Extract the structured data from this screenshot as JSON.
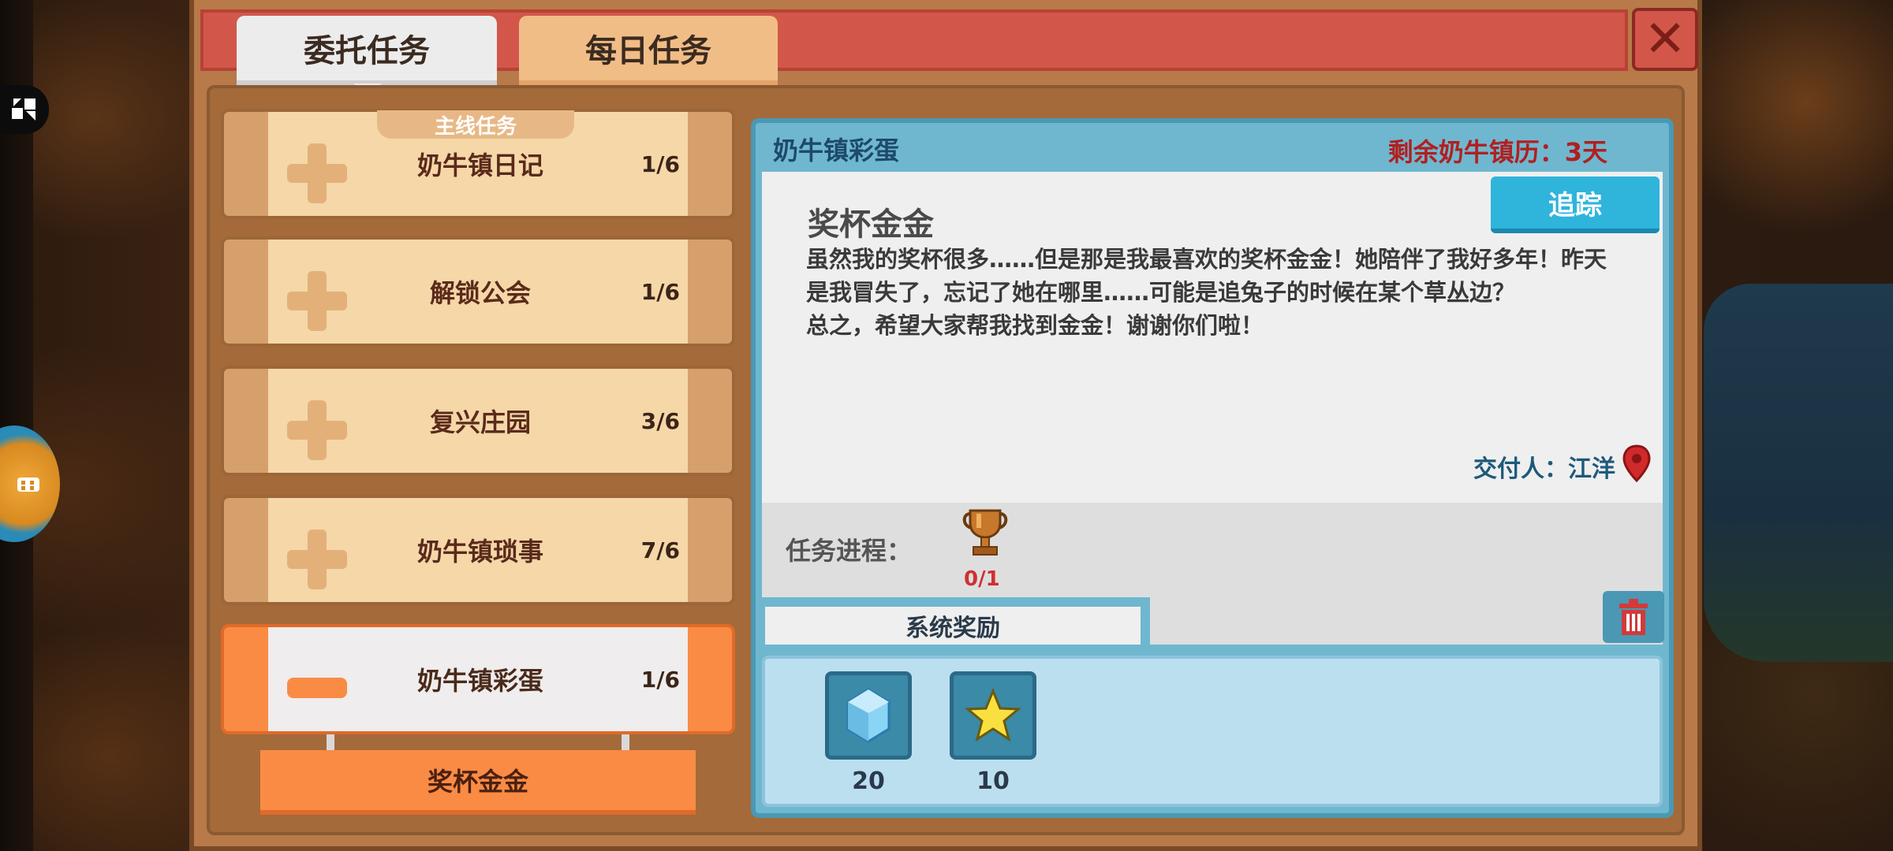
{
  "tabs": {
    "commission": "委托任务",
    "daily": "每日任务"
  },
  "close_label": "✕",
  "side_buttons": {
    "top_icon": "puzzle-expand-icon",
    "round_icon": "gamepad-icon"
  },
  "quest_list": {
    "section_tag": "主线任务",
    "items": [
      {
        "name": "奶牛镇日记",
        "progress": "1/6",
        "state": "collapsed"
      },
      {
        "name": "解锁公会",
        "progress": "1/6",
        "state": "collapsed"
      },
      {
        "name": "复兴庄园",
        "progress": "3/6",
        "state": "collapsed"
      },
      {
        "name": "奶牛镇琐事",
        "progress": "7/6",
        "state": "collapsed"
      },
      {
        "name": "奶牛镇彩蛋",
        "progress": "1/6",
        "state": "expanded"
      }
    ],
    "sub_quest": "奖杯金金"
  },
  "detail": {
    "chapter": "奶牛镇彩蛋",
    "remaining": "剩余奶牛镇历：3天",
    "quest_title": "奖杯金金",
    "track_button": "追踪",
    "description_lines": [
      "虽然我的奖杯很多……但是那是我最喜欢的奖杯金金！她陪伴了我好多年！昨天",
      "是我冒失了，忘记了她在哪里……可能是追兔子的时候在某个草丛边？",
      "总之，希望大家帮我找到金金！谢谢你们啦！"
    ],
    "giver": "交付人：江洋",
    "progress_label": "任务进程：",
    "progress_count": "0/1",
    "reward_tab": "系统奖励",
    "rewards": [
      {
        "icon": "ice-crystal-icon",
        "qty": "20"
      },
      {
        "icon": "star-icon",
        "qty": "10"
      }
    ]
  },
  "colors": {
    "panel_brown": "#b77a48",
    "header_red": "#d2574a",
    "active_orange": "#fa8b44",
    "detail_blue": "#6fb7cf",
    "track_blue": "#2fb4dc",
    "warning_red": "#b11f1f"
  }
}
